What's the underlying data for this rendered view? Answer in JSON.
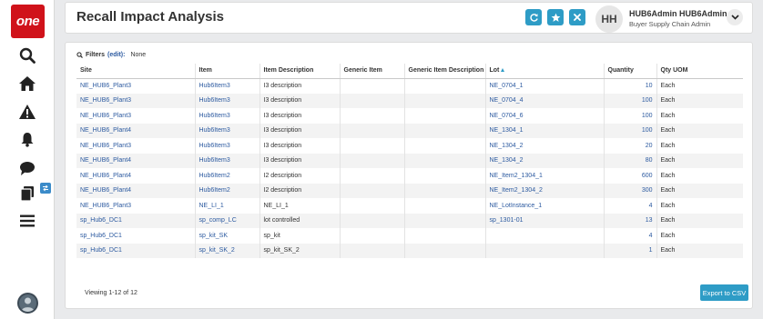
{
  "app": {
    "logo_text": "one"
  },
  "nav": {
    "icons": [
      "search-icon",
      "home-icon",
      "alert-icon",
      "bell-icon",
      "chat-icon",
      "copy-icon",
      "menu-icon"
    ]
  },
  "header": {
    "title": "Recall Impact Analysis",
    "user_initials": "HH",
    "user_name": "HUB6Admin HUB6Admin",
    "user_role": "Buyer Supply Chain Admin"
  },
  "filters": {
    "label": "Filters",
    "edit_label": "(edit):",
    "value": "None"
  },
  "table": {
    "columns": [
      "Site",
      "Item",
      "Item Description",
      "Generic Item",
      "Generic Item Description",
      "Lot",
      "Quantity",
      "Qty UOM"
    ],
    "sorted_column": "Lot",
    "rows": [
      {
        "site": "NE_HUB6_Plant3",
        "item": "Hub6Item3",
        "desc": "I3 description",
        "generic_item": "",
        "generic_desc": "",
        "lot": "NE_0704_1",
        "qty": "10",
        "uom": "Each"
      },
      {
        "site": "NE_HUB6_Plant3",
        "item": "Hub6Item3",
        "desc": "I3 description",
        "generic_item": "",
        "generic_desc": "",
        "lot": "NE_0704_4",
        "qty": "100",
        "uom": "Each"
      },
      {
        "site": "NE_HUB6_Plant3",
        "item": "Hub6Item3",
        "desc": "I3 description",
        "generic_item": "",
        "generic_desc": "",
        "lot": "NE_0704_6",
        "qty": "100",
        "uom": "Each"
      },
      {
        "site": "NE_HUB6_Plant4",
        "item": "Hub6Item3",
        "desc": "I3 description",
        "generic_item": "",
        "generic_desc": "",
        "lot": "NE_1304_1",
        "qty": "100",
        "uom": "Each"
      },
      {
        "site": "NE_HUB6_Plant3",
        "item": "Hub6Item3",
        "desc": "I3 description",
        "generic_item": "",
        "generic_desc": "",
        "lot": "NE_1304_2",
        "qty": "20",
        "uom": "Each"
      },
      {
        "site": "NE_HUB6_Plant4",
        "item": "Hub6Item3",
        "desc": "I3 description",
        "generic_item": "",
        "generic_desc": "",
        "lot": "NE_1304_2",
        "qty": "80",
        "uom": "Each"
      },
      {
        "site": "NE_HUB6_Plant4",
        "item": "Hub6Item2",
        "desc": "I2 description",
        "generic_item": "",
        "generic_desc": "",
        "lot": "NE_Item2_1304_1",
        "qty": "600",
        "uom": "Each"
      },
      {
        "site": "NE_HUB6_Plant4",
        "item": "Hub6Item2",
        "desc": "I2 description",
        "generic_item": "",
        "generic_desc": "",
        "lot": "NE_Item2_1304_2",
        "qty": "300",
        "uom": "Each"
      },
      {
        "site": "NE_HUB6_Plant3",
        "item": "NE_LI_1",
        "desc": "NE_LI_1",
        "generic_item": "",
        "generic_desc": "",
        "lot": "NE_LotInstance_1",
        "qty": "4",
        "uom": "Each"
      },
      {
        "site": "sp_Hub6_DC1",
        "item": "sp_comp_LC",
        "desc": "lot controlled",
        "generic_item": "",
        "generic_desc": "",
        "lot": "sp_1301-01",
        "qty": "13",
        "uom": "Each"
      },
      {
        "site": "sp_Hub6_DC1",
        "item": "sp_kit_SK",
        "desc": "sp_kit",
        "generic_item": "",
        "generic_desc": "",
        "lot": "",
        "qty": "4",
        "uom": "Each"
      },
      {
        "site": "sp_Hub6_DC1",
        "item": "sp_kit_SK_2",
        "desc": "sp_kit_SK_2",
        "generic_item": "",
        "generic_desc": "",
        "lot": "",
        "qty": "1",
        "uom": "Each"
      }
    ]
  },
  "footer": {
    "viewing": "Viewing 1-12 of 12",
    "export_label": "Export to CSV"
  },
  "colors": {
    "brand_red": "#d0121a",
    "accent": "#2e9cc6",
    "link": "#2c5aa0"
  }
}
